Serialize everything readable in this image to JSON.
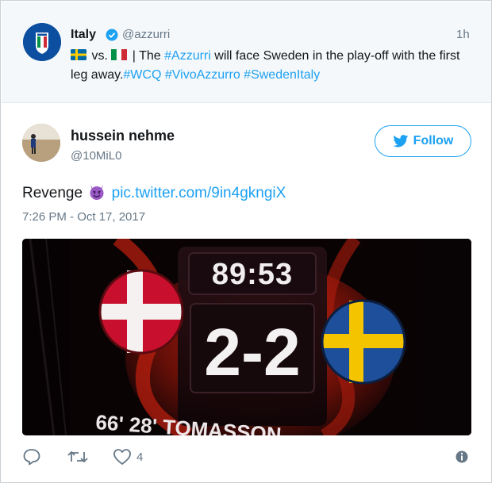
{
  "parent_tweet": {
    "name": "Italy",
    "handle": "@azzurri",
    "time": "1h",
    "text_vs": " vs. ",
    "text_body": " | The ",
    "hashtag_azzurri": "#Azzurri",
    "text_middle": " will face Sweden in the play-off with the first leg away.",
    "hashtag_wcq": "#WCQ",
    "hashtag_vivo": "#VivoAzzurro",
    "hashtag_swedenitaly": "#SwedenItaly",
    "flag_left": "sweden-flag-icon",
    "flag_right": "italy-flag-icon"
  },
  "tweet": {
    "author_name": "hussein nehme",
    "author_handle": "@10MiL0",
    "follow_label": "Follow",
    "text_prefix": "Revenge ",
    "link_text": "pic.twitter.com/9in4gkngiX",
    "date": "7:26 PM - Oct 17, 2017",
    "like_count": "4"
  },
  "media": {
    "clock": "89:53",
    "score": "2-2",
    "scorer_line": "66' 28' TOMASSON"
  },
  "colors": {
    "accent": "#1da1f2",
    "muted": "#657786",
    "text": "#14171a",
    "parent_bg": "#f5f8fa"
  }
}
